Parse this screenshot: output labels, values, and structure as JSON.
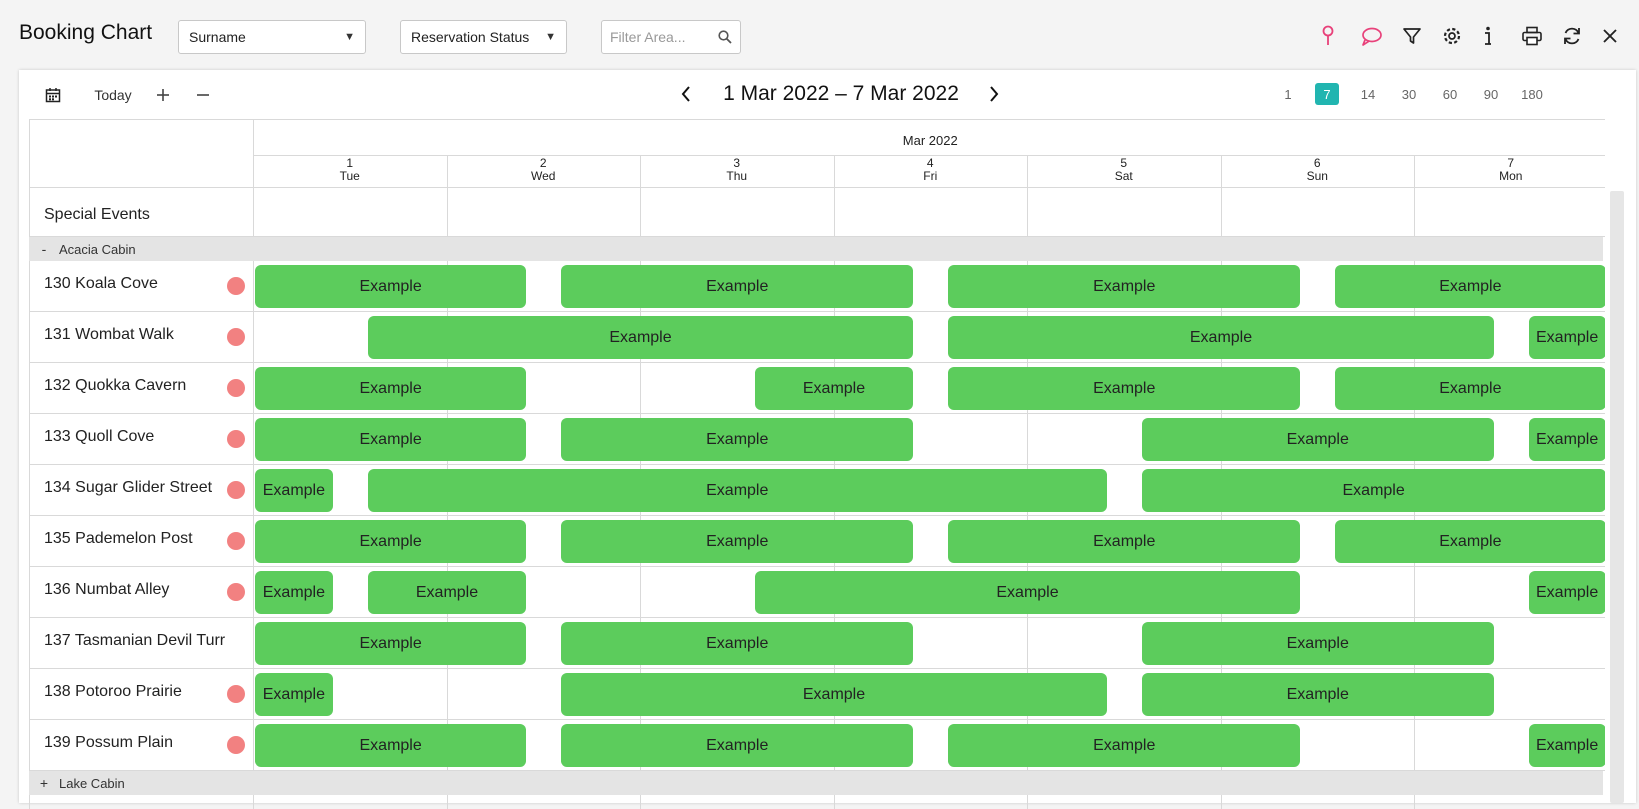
{
  "header": {
    "title": "Booking Chart",
    "sort_select": "Surname",
    "status_select": "Reservation Status",
    "filter_placeholder": "Filter Area...",
    "icons": [
      "map-pin-icon",
      "comment-icon",
      "filter-icon",
      "gear-icon",
      "info-icon",
      "print-icon",
      "refresh-icon",
      "close-icon"
    ]
  },
  "toolbar": {
    "today_label": "Today",
    "range_label": "1 Mar 2022 – 7 Mar 2022",
    "zoom_options": [
      "1",
      "7",
      "14",
      "30",
      "60",
      "90",
      "180"
    ],
    "zoom_selected": "7"
  },
  "calendar": {
    "month_label": "Mar 2022",
    "days": [
      {
        "num": "1",
        "dow": "Tue"
      },
      {
        "num": "2",
        "dow": "Wed"
      },
      {
        "num": "3",
        "dow": "Thu"
      },
      {
        "num": "4",
        "dow": "Fri"
      },
      {
        "num": "5",
        "dow": "Sat"
      },
      {
        "num": "6",
        "dow": "Sun"
      },
      {
        "num": "7",
        "dow": "Mon"
      }
    ],
    "special_events_label": "Special Events"
  },
  "groups": [
    {
      "name": "Acacia Cabin",
      "toggle": "-",
      "rooms": [
        {
          "name": "130 Koala Cove",
          "dot": true,
          "bookings": [
            {
              "label": "Example",
              "start": 0,
              "end": 1.5
            },
            {
              "label": "Example",
              "start": 1.5,
              "end": 3.5
            },
            {
              "label": "Example",
              "start": 3.5,
              "end": 5.5
            },
            {
              "label": "Example",
              "start": 5.5,
              "end": 7
            }
          ]
        },
        {
          "name": "131 Wombat Walk",
          "dot": true,
          "bookings": [
            {
              "label": "Example",
              "start": 0.5,
              "end": 3.5
            },
            {
              "label": "Example",
              "start": 3.5,
              "end": 6.5
            },
            {
              "label": "Example",
              "start": 6.5,
              "end": 7
            }
          ]
        },
        {
          "name": "132 Quokka Cavern",
          "dot": true,
          "bookings": [
            {
              "label": "Example",
              "start": 0,
              "end": 1.5
            },
            {
              "label": "Example",
              "start": 2.5,
              "end": 3.5
            },
            {
              "label": "Example",
              "start": 3.5,
              "end": 5.5
            },
            {
              "label": "Example",
              "start": 5.5,
              "end": 7
            }
          ]
        },
        {
          "name": "133 Quoll Cove",
          "dot": true,
          "bookings": [
            {
              "label": "Example",
              "start": 0,
              "end": 1.5
            },
            {
              "label": "Example",
              "start": 1.5,
              "end": 3.5
            },
            {
              "label": "Example",
              "start": 4.5,
              "end": 6.5
            },
            {
              "label": "Example",
              "start": 6.5,
              "end": 7
            }
          ]
        },
        {
          "name": "134 Sugar Glider Street",
          "dot": true,
          "bookings": [
            {
              "label": "Example",
              "start": 0,
              "end": 0.5
            },
            {
              "label": "Example",
              "start": 0.5,
              "end": 4.5
            },
            {
              "label": "Example",
              "start": 4.5,
              "end": 7
            }
          ]
        },
        {
          "name": "135 Pademelon Post",
          "dot": true,
          "bookings": [
            {
              "label": "Example",
              "start": 0,
              "end": 1.5
            },
            {
              "label": "Example",
              "start": 1.5,
              "end": 3.5
            },
            {
              "label": "Example",
              "start": 3.5,
              "end": 5.5
            },
            {
              "label": "Example",
              "start": 5.5,
              "end": 7
            }
          ]
        },
        {
          "name": "136 Numbat Alley",
          "dot": true,
          "bookings": [
            {
              "label": "Example",
              "start": 0,
              "end": 0.5
            },
            {
              "label": "Example",
              "start": 0.5,
              "end": 1.5
            },
            {
              "label": "Example",
              "start": 2.5,
              "end": 5.5
            },
            {
              "label": "Example",
              "start": 6.5,
              "end": 7
            }
          ]
        },
        {
          "name": "137 Tasmanian Devil Turr",
          "dot": false,
          "bookings": [
            {
              "label": "Example",
              "start": 0,
              "end": 1.5
            },
            {
              "label": "Example",
              "start": 1.5,
              "end": 3.5
            },
            {
              "label": "Example",
              "start": 4.5,
              "end": 6.5
            }
          ]
        },
        {
          "name": "138 Potoroo Prairie",
          "dot": true,
          "bookings": [
            {
              "label": "Example",
              "start": 0,
              "end": 0.5
            },
            {
              "label": "Example",
              "start": 1.5,
              "end": 4.5
            },
            {
              "label": "Example",
              "start": 4.5,
              "end": 6.5
            }
          ]
        },
        {
          "name": "139 Possum Plain",
          "dot": true,
          "bookings": [
            {
              "label": "Example",
              "start": 0,
              "end": 1.5
            },
            {
              "label": "Example",
              "start": 1.5,
              "end": 3.5
            },
            {
              "label": "Example",
              "start": 3.5,
              "end": 5.5
            },
            {
              "label": "Example",
              "start": 6.5,
              "end": 7
            }
          ]
        }
      ]
    },
    {
      "name": "Lake Cabin",
      "toggle": "+",
      "rooms": []
    }
  ],
  "colors": {
    "booking": "#5ccc5c",
    "status_dot": "#f28181",
    "zoom_active": "#21b5b0",
    "map_pin": "#e8417a"
  }
}
